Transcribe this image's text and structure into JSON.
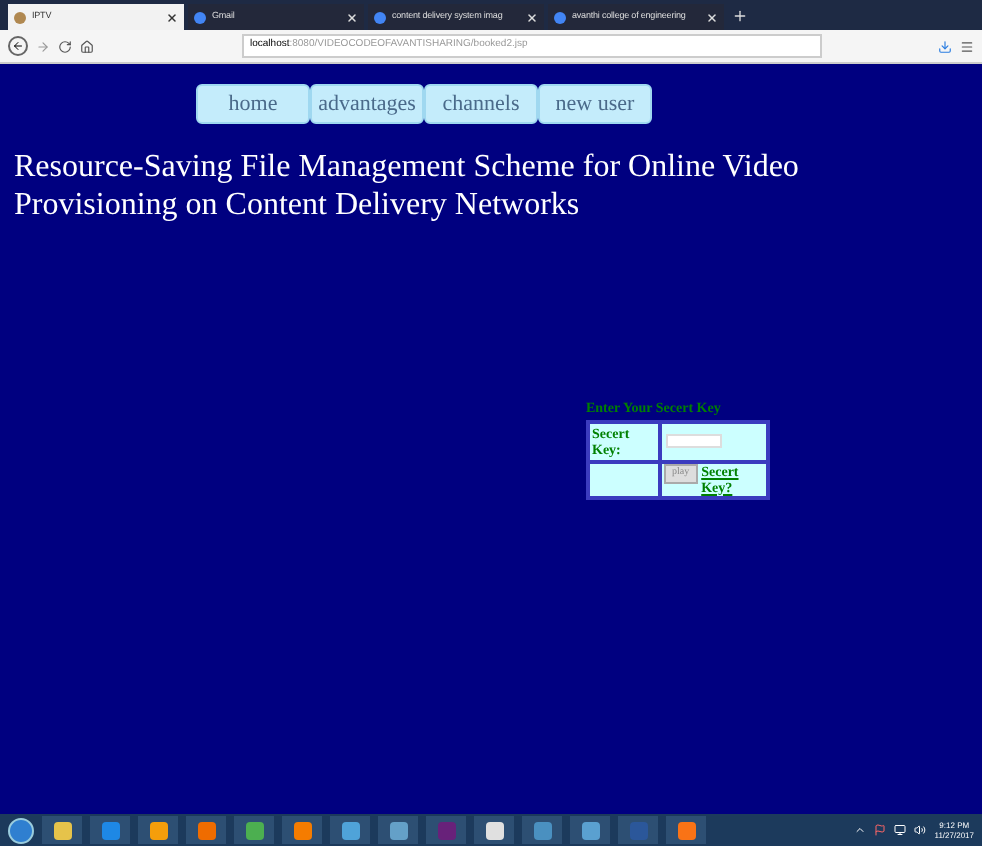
{
  "browser": {
    "tabs": [
      {
        "label": "IPTV",
        "selected": true
      },
      {
        "label": "Gmail",
        "selected": false
      },
      {
        "label": "content delivery system imag",
        "selected": false
      },
      {
        "label": "avanthi college of engineering",
        "selected": false
      }
    ],
    "url_host": "localhost",
    "url_path": ":8080/VIDEOCODEOFAVANTISHARING/booked2.jsp"
  },
  "nav": [
    {
      "label": "home"
    },
    {
      "label": "advantages"
    },
    {
      "label": "channels"
    },
    {
      "label": "new user"
    }
  ],
  "heading": "Resource-Saving File Management Scheme for Online Video Provisioning on Content Delivery Networks",
  "form": {
    "title": "Enter Your Secert Key",
    "field_label": "Secert Key:",
    "button": "play",
    "link": "Secert Key?"
  },
  "taskbar": {
    "time": "9:12 PM",
    "date": "11/27/2017"
  }
}
